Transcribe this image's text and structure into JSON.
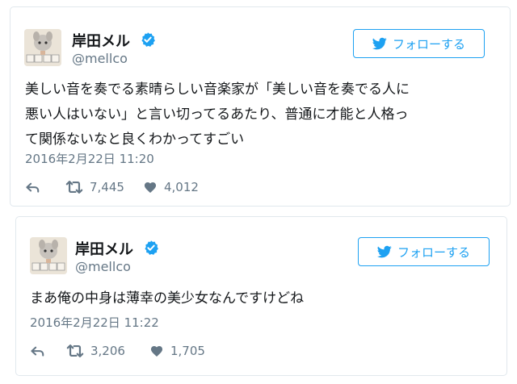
{
  "tweets": [
    {
      "name": "岸田メル",
      "handle": "@mellco",
      "follow_label": "フォローする",
      "text_lines": [
        "美しい音を奏でる素晴らしい音楽家が「美しい音を奏でる人に",
        "悪い人はいない」と言い切ってるあたり、普通に才能と人格っ",
        "て関係ないなと良くわかってすごい"
      ],
      "timestamp": "2016年2月22日 11:20",
      "retweets": "7,445",
      "likes": "4,012"
    },
    {
      "name": "岸田メル",
      "handle": "@mellco",
      "follow_label": "フォローする",
      "text_lines": [
        "まあ俺の中身は薄幸の美少女なんですけどね"
      ],
      "timestamp": "2016年2月22日 11:22",
      "retweets": "3,206",
      "likes": "1,705"
    }
  ],
  "colors": {
    "accent": "#1da1f2",
    "verified": "#1da1f2",
    "muted": "#657786",
    "text": "#14171a",
    "border": "#e1e8ed"
  },
  "icons": [
    "twitter-bird-icon",
    "verified-badge-icon",
    "reply-icon",
    "retweet-icon",
    "heart-icon"
  ]
}
